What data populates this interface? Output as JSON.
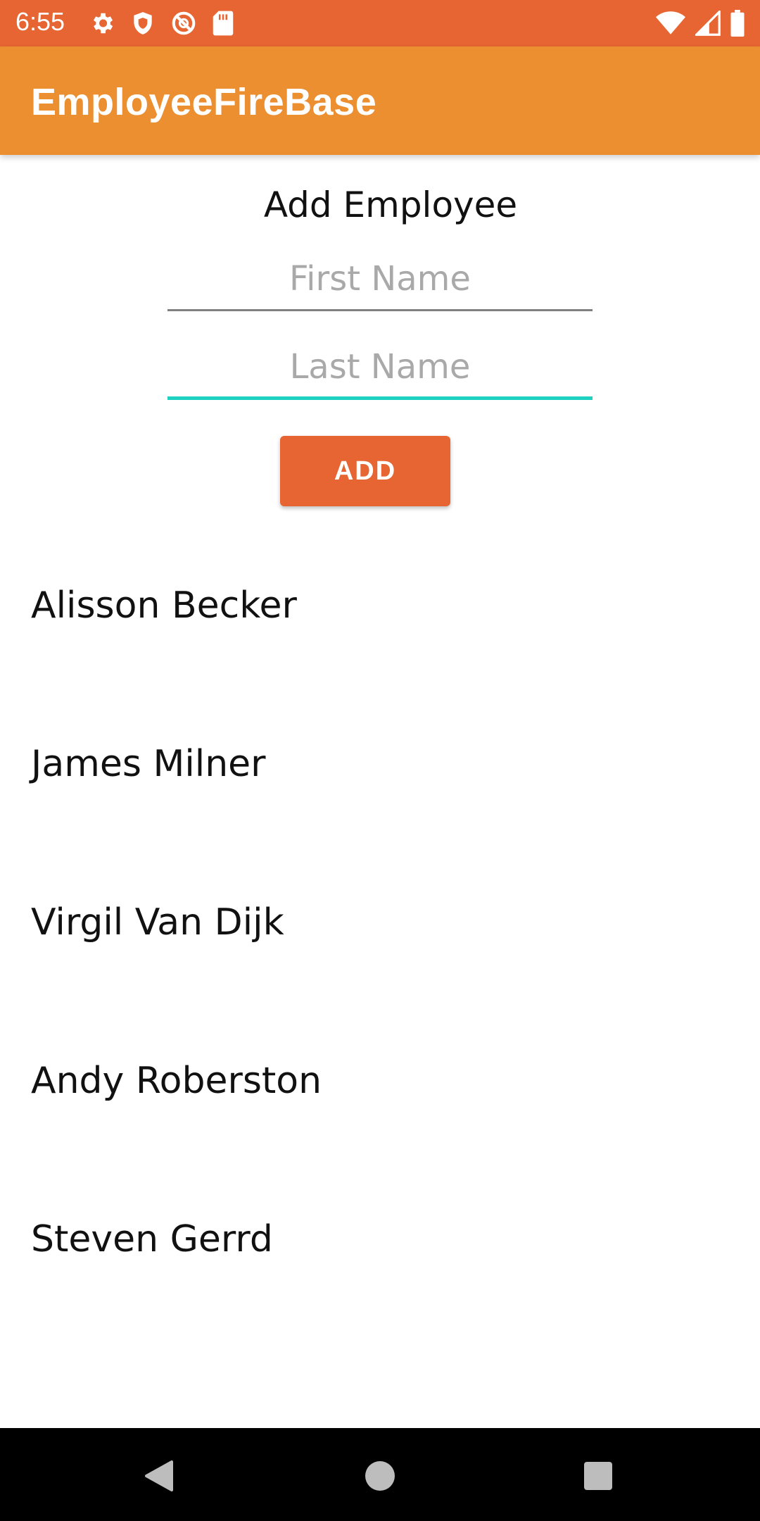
{
  "status_bar": {
    "time": "6:55",
    "background": "#e66532",
    "icons_left": [
      "settings-icon",
      "shield-icon",
      "no-sync-icon",
      "sd-card-icon"
    ],
    "icons_right": [
      "wifi-icon",
      "signal-icon",
      "battery-icon"
    ]
  },
  "app_bar": {
    "title": "EmployeeFireBase",
    "background": "#ec8f31"
  },
  "form": {
    "heading": "Add Employee",
    "first_name": {
      "value": "",
      "placeholder": "First Name"
    },
    "last_name": {
      "value": "",
      "placeholder": "Last Name",
      "focused": true
    },
    "add_label": "ADD",
    "accent": "#1fd1c1",
    "button_color": "#e66532"
  },
  "employees": [
    "Alisson Becker",
    "James Milner",
    "Virgil Van Dijk",
    "Andy Roberston",
    "Steven Gerrd"
  ],
  "nav_bar": {
    "buttons": [
      "back-icon",
      "home-icon",
      "recents-icon"
    ]
  }
}
